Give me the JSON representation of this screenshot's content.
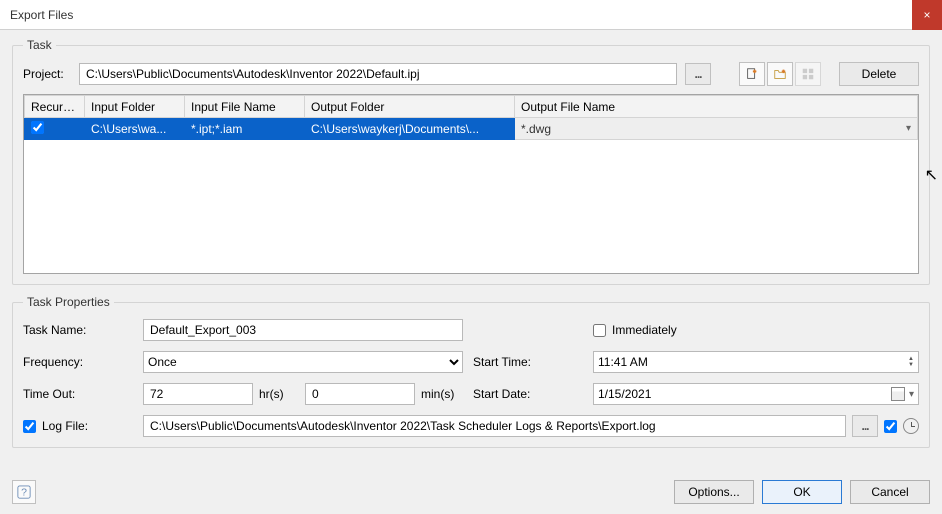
{
  "window": {
    "title": "Export Files"
  },
  "task": {
    "legend": "Task",
    "project_label": "Project:",
    "project_path": "C:\\Users\\Public\\Documents\\Autodesk\\Inventor 2022\\Default.ipj",
    "delete_label": "Delete",
    "columns": {
      "recurs": "Recurs...",
      "input_folder": "Input Folder",
      "input_file_name": "Input File Name",
      "output_folder": "Output Folder",
      "output_file_name": "Output File Name"
    },
    "row": {
      "recurs_checked": true,
      "input_folder": "C:\\Users\\wa...",
      "input_file_name": "*.ipt;*.iam",
      "output_folder": "C:\\Users\\waykerj\\Documents\\...",
      "output_file_name": "*.dwg"
    }
  },
  "props": {
    "legend": "Task Properties",
    "task_name_label": "Task Name:",
    "task_name": "Default_Export_003",
    "immediately_label": "Immediately",
    "frequency_label": "Frequency:",
    "frequency": "Once",
    "start_time_label": "Start Time:",
    "start_time": "11:41 AM",
    "time_out_label": "Time Out:",
    "hrs": "72",
    "hrs_unit": "hr(s)",
    "mins": "0",
    "mins_unit": "min(s)",
    "start_date_label": "Start Date:",
    "start_date": "1/15/2021",
    "log_file_label": "Log File:",
    "log_file": "C:\\Users\\Public\\Documents\\Autodesk\\Inventor 2022\\Task Scheduler Logs & Reports\\Export.log"
  },
  "footer": {
    "options": "Options...",
    "ok": "OK",
    "cancel": "Cancel"
  }
}
